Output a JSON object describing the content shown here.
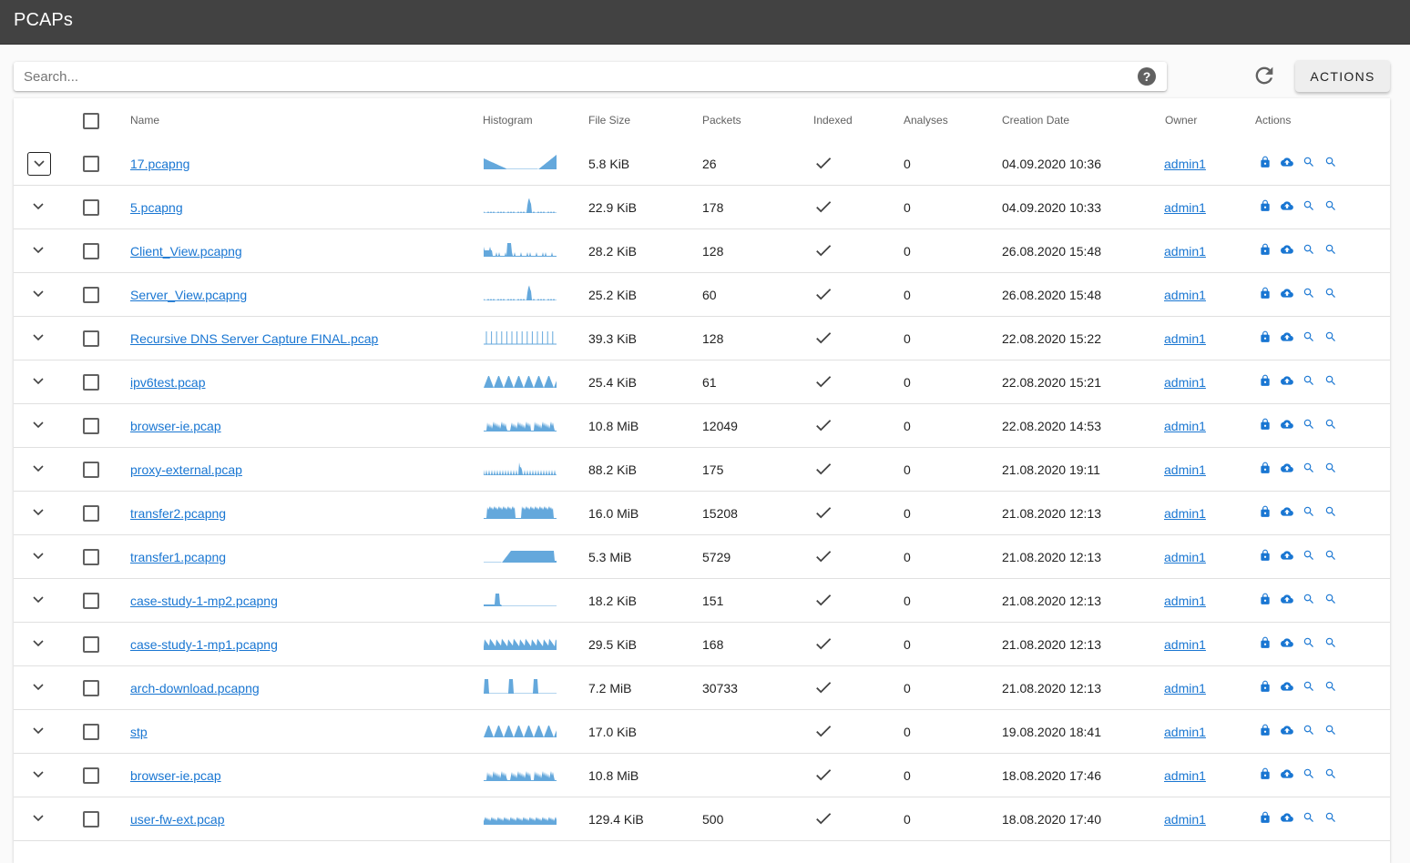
{
  "app": {
    "title": "PCAPs"
  },
  "search": {
    "placeholder": "Search...",
    "value": ""
  },
  "toolbar": {
    "actions_label": "ACTIONS"
  },
  "colors": {
    "appbar": "#424242",
    "link": "#1976d2",
    "histogram": "#64a8dc"
  },
  "table": {
    "headers": {
      "name": "Name",
      "histogram": "Histogram",
      "file_size": "File Size",
      "packets": "Packets",
      "indexed": "Indexed",
      "analyses": "Analyses",
      "creation_date": "Creation Date",
      "owner": "Owner",
      "actions": "Actions"
    },
    "action_icons": [
      "lock-icon",
      "cloud-upload-icon",
      "search-icon",
      "search-icon"
    ],
    "rows": [
      {
        "name": "17.pcapng",
        "size": "5.8 KiB",
        "packets": "26",
        "indexed": true,
        "analyses": "0",
        "date": "04.09.2020 10:36",
        "owner": "admin1",
        "hist": "valley",
        "expanded_focus": true
      },
      {
        "name": "5.pcapng",
        "size": "22.9 KiB",
        "packets": "178",
        "indexed": true,
        "analyses": "0",
        "date": "04.09.2020 10:33",
        "owner": "admin1",
        "hist": "spike"
      },
      {
        "name": "Client_View.pcapng",
        "size": "28.2 KiB",
        "packets": "128",
        "indexed": true,
        "analyses": "0",
        "date": "26.08.2020 15:48",
        "owner": "admin1",
        "hist": "multi"
      },
      {
        "name": "Server_View.pcapng",
        "size": "25.2 KiB",
        "packets": "60",
        "indexed": true,
        "analyses": "0",
        "date": "26.08.2020 15:48",
        "owner": "admin1",
        "hist": "spike"
      },
      {
        "name": "Recursive DNS Server Capture FINAL.pcap",
        "size": "39.3 KiB",
        "packets": "128",
        "indexed": true,
        "analyses": "0",
        "date": "22.08.2020 15:22",
        "owner": "admin1",
        "hist": "lines"
      },
      {
        "name": "ipv6test.pcap",
        "size": "25.4 KiB",
        "packets": "61",
        "indexed": true,
        "analyses": "0",
        "date": "22.08.2020 15:21",
        "owner": "admin1",
        "hist": "teeth"
      },
      {
        "name": "browser-ie.pcap",
        "size": "10.8 MiB",
        "packets": "12049",
        "indexed": true,
        "analyses": "0",
        "date": "22.08.2020 14:53",
        "owner": "admin1",
        "hist": "jagged"
      },
      {
        "name": "proxy-external.pcap",
        "size": "88.2 KiB",
        "packets": "175",
        "indexed": true,
        "analyses": "0",
        "date": "21.08.2020 19:11",
        "owner": "admin1",
        "hist": "sparse"
      },
      {
        "name": "transfer2.pcapng",
        "size": "16.0 MiB",
        "packets": "15208",
        "indexed": true,
        "analyses": "0",
        "date": "21.08.2020 12:13",
        "owner": "admin1",
        "hist": "twohump"
      },
      {
        "name": "transfer1.pcapng",
        "size": "5.3 MiB",
        "packets": "5729",
        "indexed": true,
        "analyses": "0",
        "date": "21.08.2020 12:13",
        "owner": "admin1",
        "hist": "plateau"
      },
      {
        "name": "case-study-1-mp2.pcapng",
        "size": "18.2 KiB",
        "packets": "151",
        "indexed": true,
        "analyses": "0",
        "date": "21.08.2020 12:13",
        "owner": "admin1",
        "hist": "early"
      },
      {
        "name": "case-study-1-mp1.pcapng",
        "size": "29.5 KiB",
        "packets": "168",
        "indexed": true,
        "analyses": "0",
        "date": "21.08.2020 12:13",
        "owner": "admin1",
        "hist": "comb"
      },
      {
        "name": "arch-download.pcapng",
        "size": "7.2 MiB",
        "packets": "30733",
        "indexed": true,
        "analyses": "0",
        "date": "21.08.2020 12:13",
        "owner": "admin1",
        "hist": "three"
      },
      {
        "name": "stp",
        "size": "17.0 KiB",
        "packets": "",
        "indexed": true,
        "analyses": "0",
        "date": "19.08.2020 18:41",
        "owner": "admin1",
        "hist": "teeth"
      },
      {
        "name": "browser-ie.pcap",
        "size": "10.8 MiB",
        "packets": "",
        "indexed": true,
        "analyses": "0",
        "date": "18.08.2020 17:46",
        "owner": "admin1",
        "hist": "jagged"
      },
      {
        "name": "user-fw-ext.pcap",
        "size": "129.4 KiB",
        "packets": "500",
        "indexed": true,
        "analyses": "0",
        "date": "18.08.2020 17:40",
        "owner": "admin1",
        "hist": "noise"
      }
    ]
  }
}
